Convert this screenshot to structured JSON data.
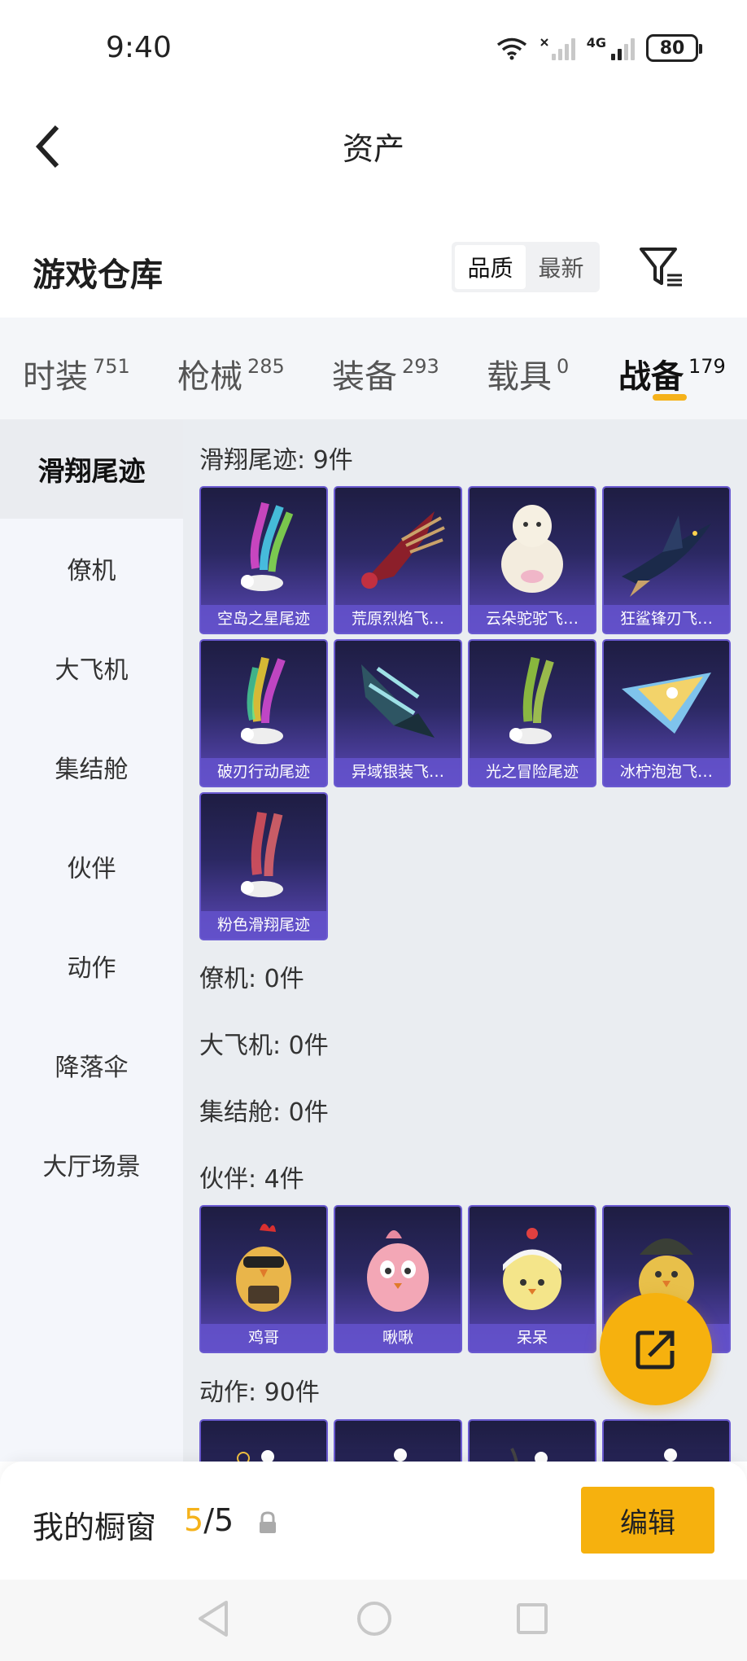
{
  "status_bar": {
    "time": "9:40",
    "battery": "80",
    "network": "4G"
  },
  "header": {
    "title": "资产"
  },
  "warehouse": {
    "title": "游戏仓库",
    "sort_options": [
      "品质",
      "最新"
    ],
    "active_sort": "品质"
  },
  "category_tabs": [
    {
      "label": "时装",
      "count": "751"
    },
    {
      "label": "枪械",
      "count": "285"
    },
    {
      "label": "装备",
      "count": "293"
    },
    {
      "label": "载具",
      "count": "0"
    },
    {
      "label": "战备",
      "count": "179",
      "active": true
    }
  ],
  "sidebar": {
    "items": [
      "滑翔尾迹",
      "僚机",
      "大飞机",
      "集结舱",
      "伙伴",
      "动作",
      "降落伞",
      "大厅场景"
    ],
    "active": "滑翔尾迹"
  },
  "sections": {
    "glide": {
      "title": "滑翔尾迹: 9件",
      "items": [
        "空岛之星尾迹",
        "荒原烈焰飞…",
        "云朵驼驼飞…",
        "狂鲨锋刃飞…",
        "破刃行动尾迹",
        "异域银装飞…",
        "光之冒险尾迹",
        "冰柠泡泡飞…",
        "粉色滑翔尾迹"
      ]
    },
    "wingman": {
      "title": "僚机: 0件"
    },
    "plane": {
      "title": "大飞机: 0件"
    },
    "pod": {
      "title": "集结舱: 0件"
    },
    "partner": {
      "title": "伙伴: 4件",
      "items": [
        "鸡哥",
        "啾啾",
        "呆呆",
        ""
      ]
    },
    "action": {
      "title": "动作: 90件"
    }
  },
  "icons": {
    "back": "chevron-left-icon",
    "filter": "filter-icon",
    "share": "share-icon",
    "lock": "lock-icon"
  },
  "showcase": {
    "label": "我的橱窗",
    "current": "5",
    "total": "/5",
    "edit_label": "编辑"
  },
  "colors": {
    "accent": "#f6b10e",
    "card_purple": "#5b48b8"
  }
}
